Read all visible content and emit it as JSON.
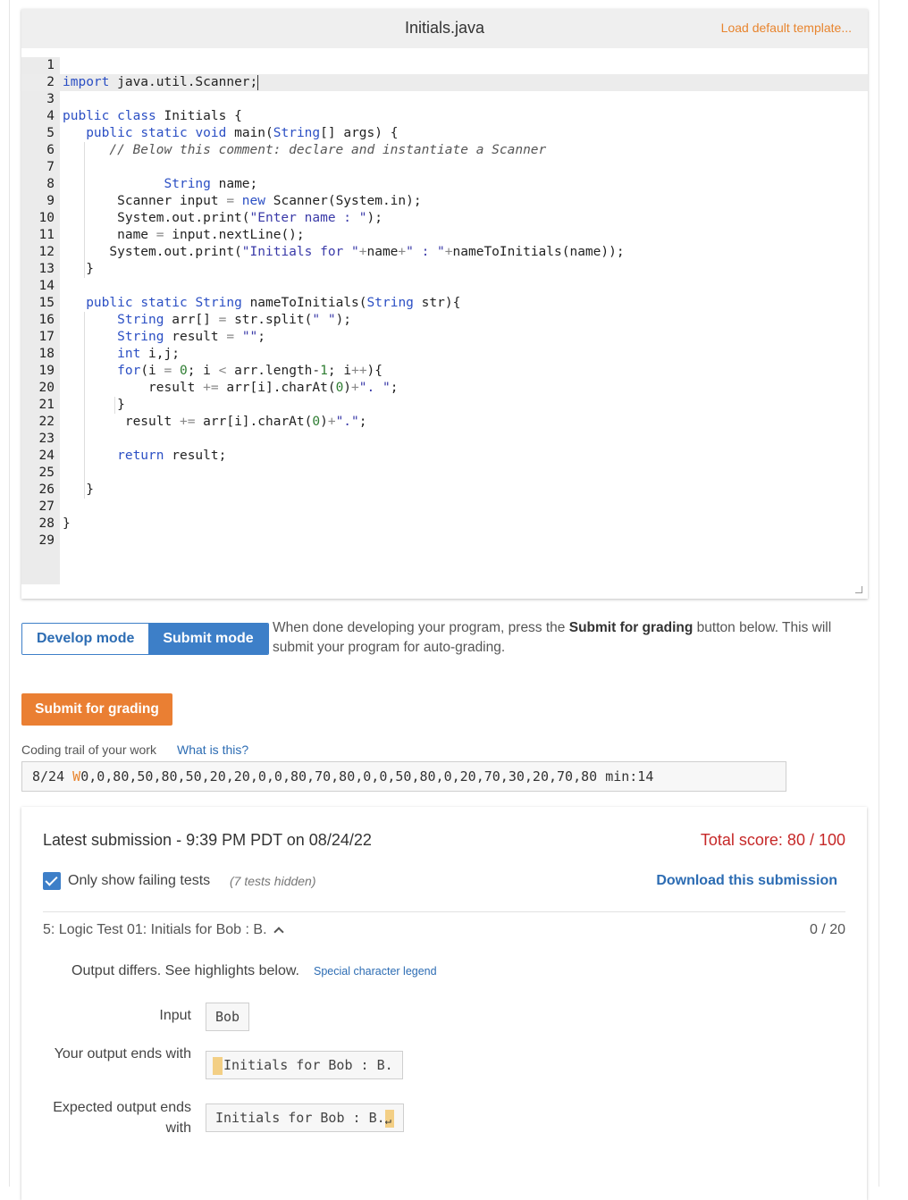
{
  "editor": {
    "filename": "Initials.java",
    "load_template": "Load default template...",
    "lines": [
      {
        "n": "1",
        "code": ""
      },
      {
        "n": "2",
        "code": "import java.util.Scanner;"
      },
      {
        "n": "3",
        "code": ""
      },
      {
        "n": "4",
        "code": "public class Initials {"
      },
      {
        "n": "5",
        "code": "   public static void main(String[] args) {"
      },
      {
        "n": "6",
        "code": "      // Below this comment: declare and instantiate a Scanner"
      },
      {
        "n": "7",
        "code": ""
      },
      {
        "n": "8",
        "code": "             String name;"
      },
      {
        "n": "9",
        "code": "       Scanner input = new Scanner(System.in);"
      },
      {
        "n": "10",
        "code": "       System.out.print(\"Enter name : \");"
      },
      {
        "n": "11",
        "code": "       name = input.nextLine();"
      },
      {
        "n": "12",
        "code": "      System.out.print(\"Initials for \"+name+\" : \"+nameToInitials(name));"
      },
      {
        "n": "13",
        "code": "   }"
      },
      {
        "n": "14",
        "code": ""
      },
      {
        "n": "15",
        "code": "   public static String nameToInitials(String str){"
      },
      {
        "n": "16",
        "code": "       String arr[] = str.split(\" \");"
      },
      {
        "n": "17",
        "code": "       String result = \"\";"
      },
      {
        "n": "18",
        "code": "       int i,j;"
      },
      {
        "n": "19",
        "code": "       for(i = 0; i < arr.length-1; i++){"
      },
      {
        "n": "20",
        "code": "           result += arr[i].charAt(0)+\". \";"
      },
      {
        "n": "21",
        "code": "       }"
      },
      {
        "n": "22",
        "code": "        result += arr[i].charAt(0)+\".\";"
      },
      {
        "n": "23",
        "code": ""
      },
      {
        "n": "24",
        "code": "       return result;"
      },
      {
        "n": "25",
        "code": ""
      },
      {
        "n": "26",
        "code": "   }"
      },
      {
        "n": "27",
        "code": ""
      },
      {
        "n": "28",
        "code": "}"
      },
      {
        "n": "29",
        "code": ""
      }
    ]
  },
  "mode": {
    "develop_label": "Develop mode",
    "submit_label": "Submit mode",
    "desc_before": "When done developing your program, press the ",
    "desc_bold": "Submit for grading",
    "desc_after": " button below. This will submit your program for auto-grading."
  },
  "submit_button": "Submit for grading",
  "trail": {
    "label": "Coding trail of your work",
    "what_link": "What is this?",
    "date": "8/24",
    "w_token": "W",
    "sequence": "0,0,80,50,80,50,20,20,0,0,80,70,80,0,0,50,80,0,20,70,30,20,70,80",
    "min": "min:14"
  },
  "results": {
    "latest": "Latest submission - 9:39 PM PDT on 08/24/22",
    "total_score": "Total score: 80 / 100",
    "only_failing": "Only show failing tests",
    "tests_hidden": "(7 tests hidden)",
    "download": "Download this submission",
    "test_title": "5: Logic Test 01: Initials for Bob : B.",
    "test_score": "0 / 20",
    "output_differs": "Output differs. See highlights below.",
    "legend_link": "Special character legend",
    "input_label": "Input",
    "input_value": "Bob",
    "your_output_label": "Your output ends with",
    "your_output_value": "Initials for Bob : B.",
    "expected_label": "Expected output ends with",
    "expected_value": "Initials for Bob : B."
  },
  "colors": {
    "accent_blue": "#3d7fc8",
    "accent_orange": "#ea7f33",
    "score_red": "#c62828",
    "highlight": "#f3cf85"
  }
}
